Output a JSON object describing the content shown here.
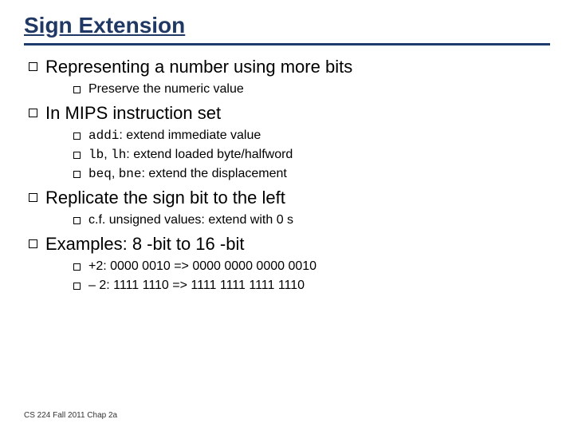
{
  "title": "Sign Extension",
  "footer": "CS 224 Fall 2011 Chap 2a",
  "b1": {
    "text": "Representing a number using more bits"
  },
  "b1s1": {
    "text": "Preserve the numeric value"
  },
  "b2": {
    "text": "In MIPS instruction set"
  },
  "b2s1": {
    "code": "addi",
    "rest": ": extend immediate value"
  },
  "b2s2": {
    "code1": "lb",
    "sep": ", ",
    "code2": "lh",
    "rest": ": extend loaded byte/halfword"
  },
  "b2s3": {
    "code1": "beq",
    "sep": ", ",
    "code2": "bne",
    "rest": ": extend the displacement"
  },
  "b3": {
    "text": "Replicate the sign bit to the left"
  },
  "b3s1": {
    "text": "c.f. unsigned values: extend with 0 s"
  },
  "b4": {
    "text": "Examples: 8 -bit to 16 -bit"
  },
  "b4s1": {
    "text": "+2: 0000 0010 => 0000 0000 0000 0010"
  },
  "b4s2": {
    "text": "– 2: 1111 1110 => 1111 1111 1111 1110"
  }
}
